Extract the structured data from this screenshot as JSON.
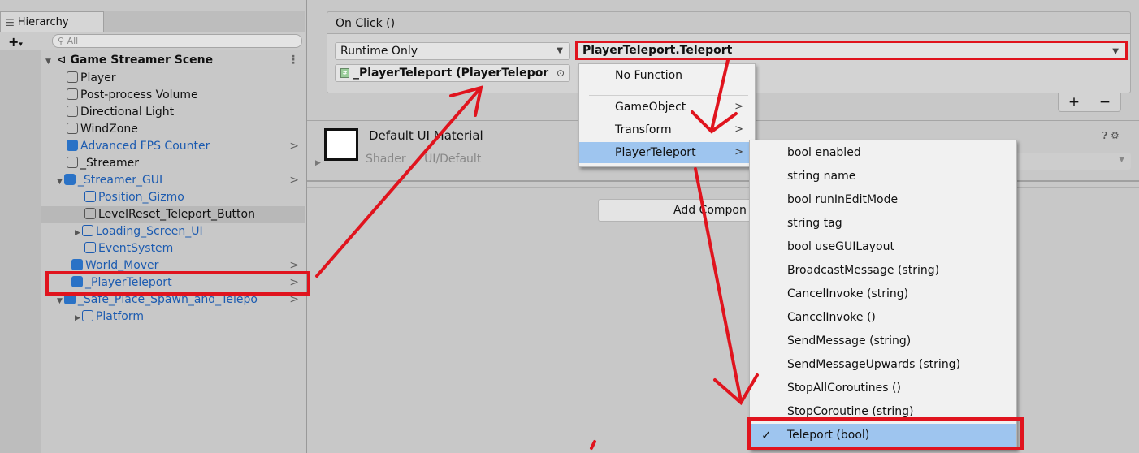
{
  "hierarchy": {
    "tab_label": "Hierarchy",
    "search_placeholder": "All",
    "scene_name": "Game Streamer Scene",
    "items": [
      {
        "label": "Player"
      },
      {
        "label": "Post-process Volume"
      },
      {
        "label": "Directional Light"
      },
      {
        "label": "WindZone"
      },
      {
        "label": "Advanced FPS Counter"
      },
      {
        "label": "_Streamer"
      },
      {
        "label": "_Streamer_GUI"
      },
      {
        "label": "Position_Gizmo"
      },
      {
        "label": "LevelReset_Teleport_Button"
      },
      {
        "label": "Loading_Screen_UI"
      },
      {
        "label": "EventSystem"
      },
      {
        "label": "World_Mover"
      },
      {
        "label": "_PlayerTeleport"
      },
      {
        "label": "_Safe_Place_Spawn_and_Telepo"
      },
      {
        "label": "Platform"
      }
    ]
  },
  "inspector": {
    "event_header": "On Click ()",
    "call_state": "Runtime Only",
    "function": "PlayerTeleport.Teleport",
    "target_object": "_PlayerTeleport (PlayerTelepor",
    "plus_label": "+",
    "minus_label": "−",
    "material_name": "Default UI Material",
    "shader_label": "Shader",
    "shader_value": "UI/Default",
    "add_component_label": "Add Compon"
  },
  "menu_level1": [
    {
      "label": "No Function",
      "submenu": false
    },
    {
      "label": "GameObject",
      "submenu": true
    },
    {
      "label": "Transform",
      "submenu": true
    },
    {
      "label": "PlayerTeleport",
      "submenu": true
    }
  ],
  "menu_level2": [
    {
      "label": "bool enabled"
    },
    {
      "label": "string name"
    },
    {
      "label": "bool runInEditMode"
    },
    {
      "label": "string tag"
    },
    {
      "label": "bool useGUILayout"
    },
    {
      "label": "BroadcastMessage (string)"
    },
    {
      "label": "CancelInvoke (string)"
    },
    {
      "label": "CancelInvoke ()"
    },
    {
      "label": "SendMessage (string)"
    },
    {
      "label": "SendMessageUpwards (string)"
    },
    {
      "label": "StopAllCoroutines ()"
    },
    {
      "label": "StopCoroutine (string)"
    },
    {
      "label": "Teleport (bool)"
    }
  ],
  "colors": {
    "annotation_red": "#e0141e",
    "highlight_blue": "#9ec5ef",
    "prefab_blue": "#1c5bb0"
  }
}
